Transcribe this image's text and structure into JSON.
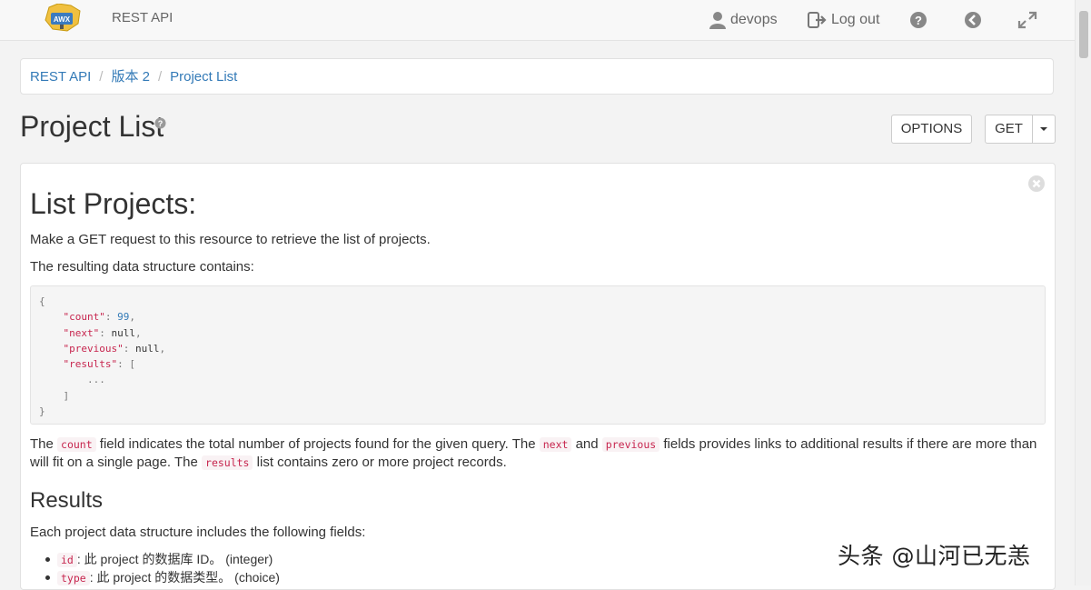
{
  "navbar": {
    "logo_text": "AWX",
    "brand": "REST API",
    "user_label": "devops",
    "logout_label": "Log out"
  },
  "breadcrumb": {
    "items": [
      "REST API",
      "版本 2",
      "Project List"
    ]
  },
  "page": {
    "title": "Project List",
    "options_button": "OPTIONS",
    "get_button": "GET"
  },
  "content": {
    "heading": "List Projects:",
    "intro": "Make a GET request to this resource to retrieve the list of projects.",
    "structure_label": "The resulting data structure contains:",
    "code_lines": [
      "{",
      "    \"count\": 99,",
      "    \"next\": null,",
      "    \"previous\": null,",
      "    \"results\": [",
      "        ...",
      "    ]",
      "}"
    ],
    "para": {
      "t1": "The ",
      "c1": "count",
      "t2": " field indicates the total number of projects found for the given query. The ",
      "c2": "next",
      "t3": " and ",
      "c3": "previous",
      "t4": " fields provides links to additional results if there are more than will fit on a single page. The ",
      "c4": "results",
      "t5": " list contains zero or more project records."
    },
    "results_heading": "Results",
    "results_intro": "Each project data structure includes the following fields:",
    "fields": [
      {
        "code": "id",
        "desc": ": 此 project 的数据库 ID。 (integer)"
      },
      {
        "code": "type",
        "desc": ": 此 project 的数据类型。 (choice)"
      }
    ]
  },
  "watermark": "头条 @山河已无恙"
}
